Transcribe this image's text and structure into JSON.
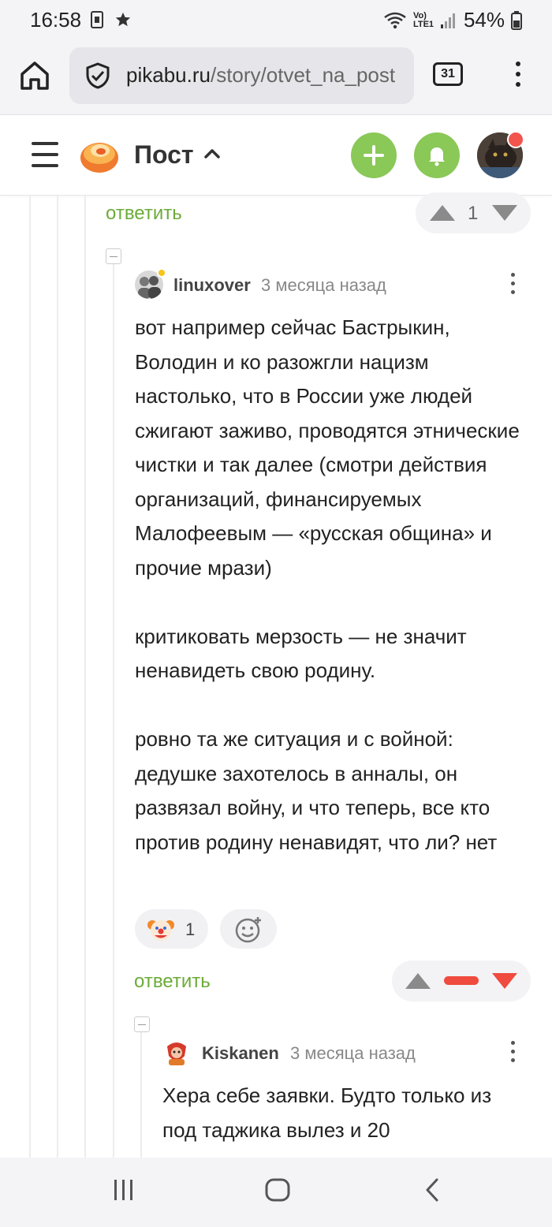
{
  "status": {
    "time": "16:58",
    "network_label": "Vo) LTE1",
    "battery": "54%"
  },
  "browser": {
    "url_host": "pikabu.ru",
    "url_path": "/story/otvet_na_post",
    "tabs_count": "31"
  },
  "header": {
    "title": "Пост",
    "accent_color": "#8ac858"
  },
  "top_actions": {
    "reply_label": "ответить",
    "vote_count": "1"
  },
  "comment1": {
    "author": "linuxover",
    "time": "3 месяца назад",
    "paragraphs": [
      "вот например сейчас Бастрыкин, Володин и ко разожгли нацизм настолько, что в России уже людей сжигают заживо, проводятся этнические чистки и так далее (смотри действия организаций, финансируемых Малофеевым — «русская община» и прочие мрази)",
      "критиковать мерзость — не значит ненавидеть свою родину.",
      "ровно та же ситуация и с войной: дедушке захотелось в анналы, он развязал войну, и что теперь, все кто против родину ненавидят, что ли? нет"
    ],
    "reaction_clown_count": "1",
    "reply_label": "ответить"
  },
  "comment2": {
    "author": "Kiskanen",
    "time": "3 месяца назад",
    "text": "Хера себе заявки. Будто только из под таджика вылез и 20"
  },
  "colors": {
    "reply_green": "#6cab39",
    "vote_red": "#ef4b3f",
    "status_bg": "#f4f4f6"
  }
}
